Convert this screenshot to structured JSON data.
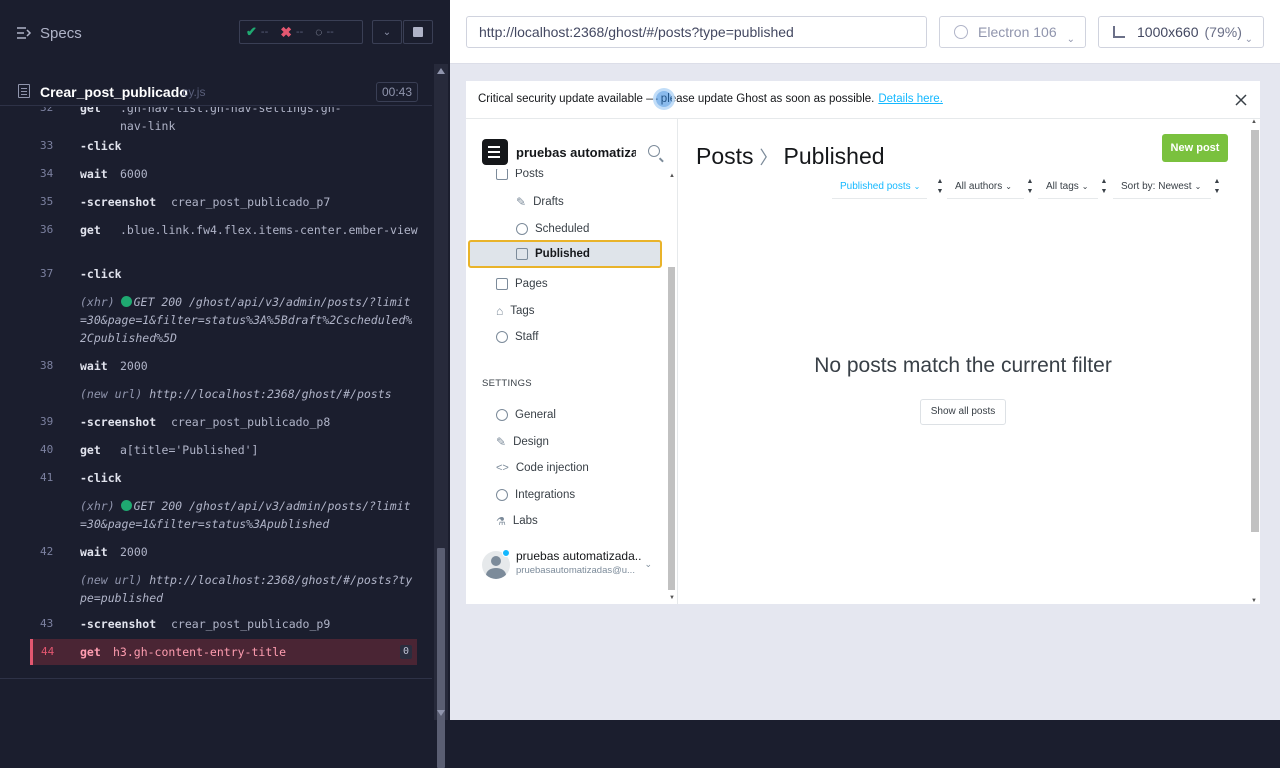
{
  "reporter": {
    "specs_label": "Specs",
    "stats": {
      "passed": "--",
      "failed": "--",
      "pending": "--"
    },
    "spec_file": {
      "name": "Crear_post_publicado",
      "ext": ".cy.js",
      "time": "00:43"
    },
    "commands": [
      {
        "num": "32",
        "name": "get",
        "msg": ".gh-nav-list.gh-nav-settings.gh-nav-link"
      },
      {
        "num": "33",
        "name": "-click",
        "msg": ""
      },
      {
        "num": "34",
        "name": "wait",
        "msg": "6000"
      },
      {
        "num": "35",
        "name": "-screenshot",
        "msg": "crear_post_publicado_p7"
      },
      {
        "num": "36",
        "name": "get",
        "msg": ".blue.link.fw4.flex.items-center.ember-view"
      },
      {
        "num": "37",
        "name": "-click",
        "msg": ""
      },
      {
        "num": "",
        "name": "(xhr)",
        "msg": "GET 200 /ghost/api/v3/admin/posts/?limit=30&page=1&filter=status%3A%5Bdraft%2Cscheduled%2Cpublished%5D"
      },
      {
        "num": "38",
        "name": "wait",
        "msg": "2000"
      },
      {
        "num": "",
        "name": "(new url)",
        "msg": "http://localhost:2368/ghost/#/posts"
      },
      {
        "num": "39",
        "name": "-screenshot",
        "msg": "crear_post_publicado_p8"
      },
      {
        "num": "40",
        "name": "get",
        "msg": "a[title='Published']"
      },
      {
        "num": "41",
        "name": "-click",
        "msg": ""
      },
      {
        "num": "",
        "name": "(xhr)",
        "msg": "GET 200 /ghost/api/v3/admin/posts/?limit=30&page=1&filter=status%3Apublished"
      },
      {
        "num": "42",
        "name": "wait",
        "msg": "2000"
      },
      {
        "num": "",
        "name": "(new url)",
        "msg": "http://localhost:2368/ghost/#/posts?type=published"
      },
      {
        "num": "43",
        "name": "-screenshot",
        "msg": "crear_post_publicado_p9"
      },
      {
        "num": "44",
        "name": "get",
        "msg": "h3.gh-content-entry-title",
        "badge": "0"
      }
    ]
  },
  "aut": {
    "url": "http://localhost:2368/ghost/#/posts?type=published",
    "browser": "Electron 106",
    "viewport": "1000x660",
    "viewport_pct": "(79%)"
  },
  "ghost": {
    "notice": {
      "text": "Critical security update available — please update Ghost as soon as possible.",
      "link": "Details here."
    },
    "site_name": "pruebas automatiza...",
    "nav": {
      "posts": "Posts",
      "drafts": "Drafts",
      "scheduled": "Scheduled",
      "published": "Published",
      "pages": "Pages",
      "tags": "Tags",
      "staff": "Staff"
    },
    "settings_heading": "SETTINGS",
    "settings": {
      "general": "General",
      "design": "Design",
      "code_injection": "Code injection",
      "integrations": "Integrations",
      "labs": "Labs"
    },
    "user": {
      "name": "pruebas automatizada...",
      "email": "pruebasautomatizadas@u..."
    },
    "title": {
      "section": "Posts",
      "sub": "Published"
    },
    "new_post": "New post",
    "filters": {
      "type": "Published posts",
      "authors": "All authors",
      "tags": "All tags",
      "sort": "Sort by: Newest"
    },
    "empty_message": "No posts match the current filter",
    "show_all": "Show all posts"
  }
}
